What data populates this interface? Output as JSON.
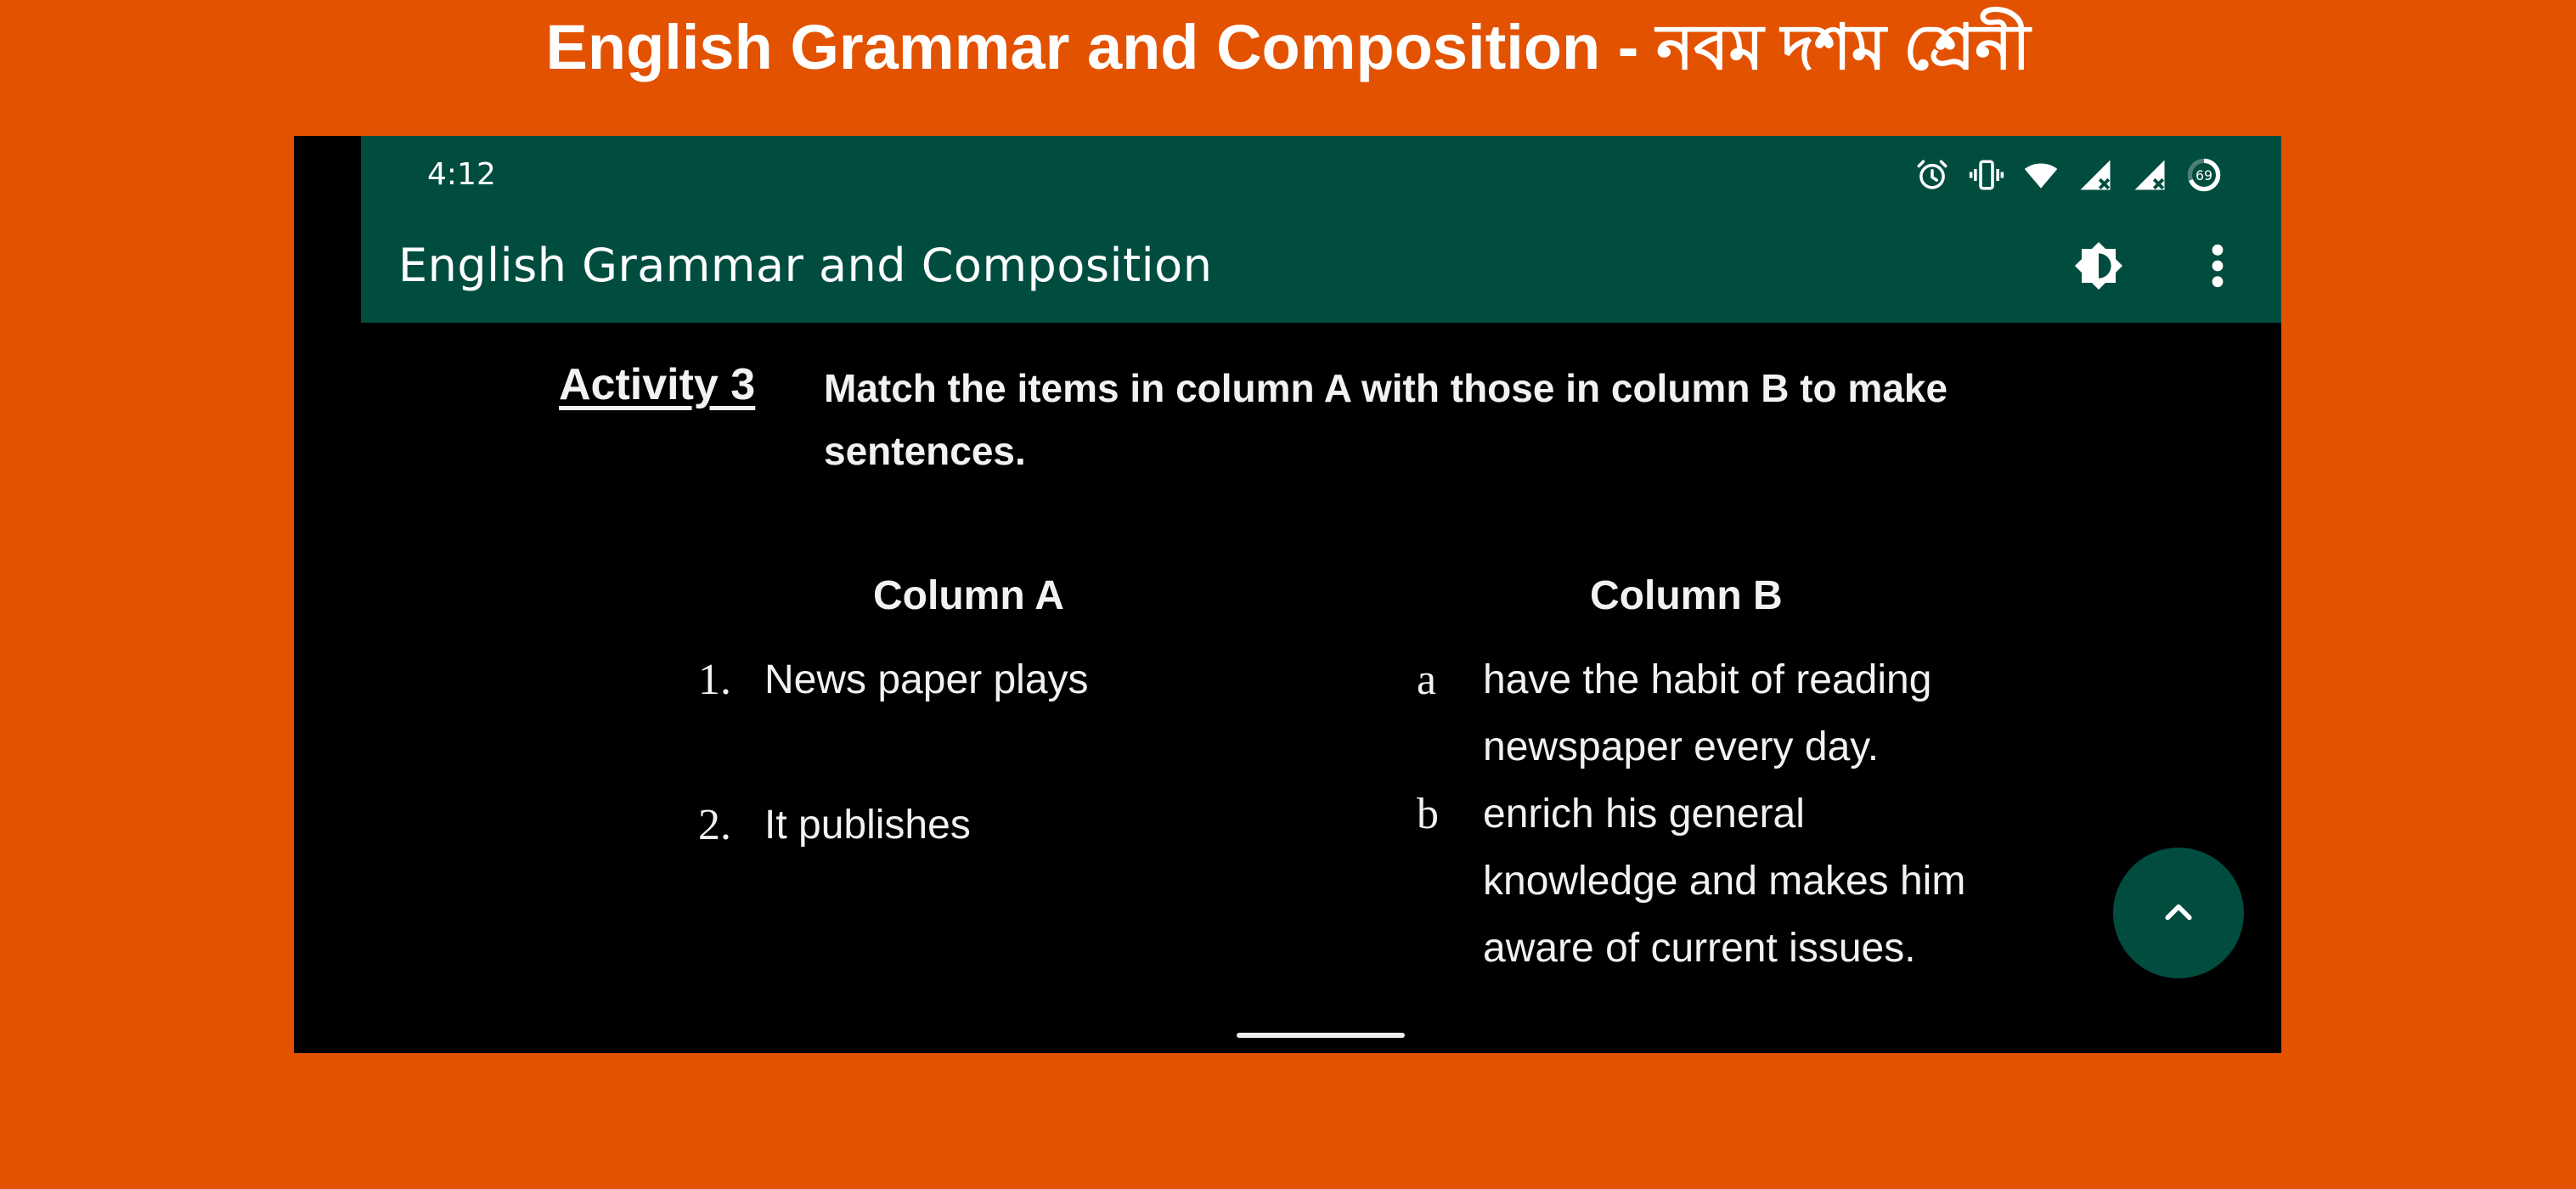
{
  "banner": {
    "title": "English Grammar and Composition - নবম দশম শ্রেনী"
  },
  "status_bar": {
    "time": "4:12",
    "icons": [
      "alarm-icon",
      "vibrate-icon",
      "wifi-icon",
      "signal-no-service-icon",
      "signal-no-service-icon",
      "battery-ring-icon"
    ],
    "battery_level": "69"
  },
  "app_bar": {
    "title": "English Grammar and Composition",
    "actions": [
      "brightness-theme-icon",
      "more-vert-icon"
    ]
  },
  "content": {
    "activity_label": "Activity 3",
    "instruction": "Match the items in column A with those in column B to make sentences.",
    "column_a": {
      "heading": "Column A",
      "items": [
        {
          "marker": "1.",
          "text": "News paper plays"
        },
        {
          "marker": "2.",
          "text": "It publishes"
        }
      ]
    },
    "column_b": {
      "heading": "Column B",
      "items": [
        {
          "marker": "a",
          "lines": [
            "have the habit of reading",
            "newspaper every day."
          ]
        },
        {
          "marker": "b",
          "lines": [
            "enrich his general",
            "knowledge and makes him",
            "aware of current issues."
          ]
        }
      ]
    }
  },
  "fab": {
    "icon": "chevron-up-icon"
  },
  "colors": {
    "background": "#E35200",
    "primary": "#004D40",
    "page": "#000000",
    "text": "#FFFFFF"
  }
}
